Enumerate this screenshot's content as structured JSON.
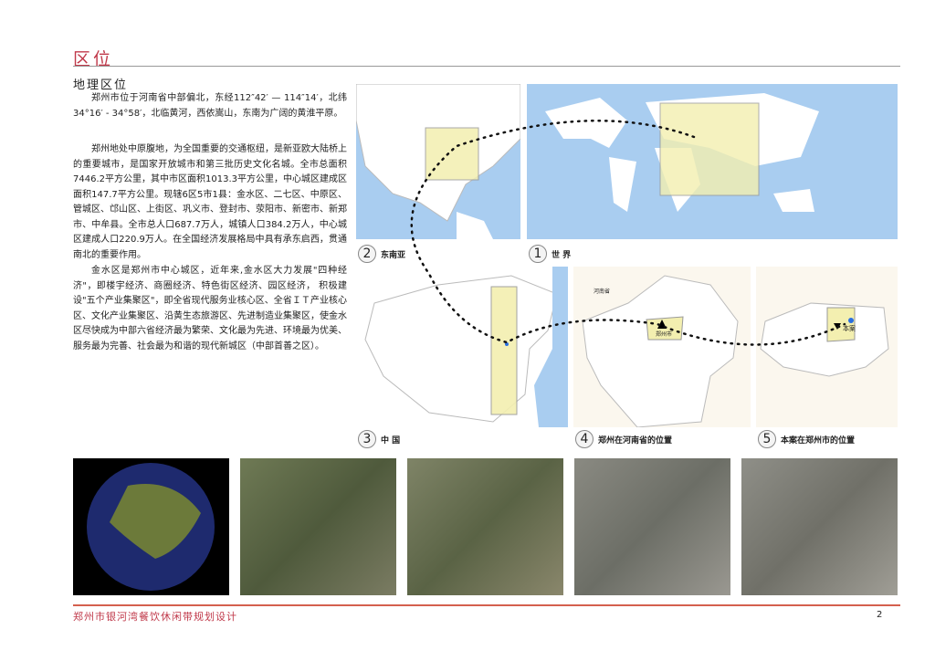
{
  "header": {
    "title": "区位"
  },
  "section": {
    "title": "地理区位",
    "paragraphs": [
      "郑州市位于河南省中部偏北，东经112″42′ — 114″14′，北纬34°16′ - 34°58′，北临黄河，西依嵩山，东南为广阔的黄淮平原。",
      "郑州地处中原腹地，为全国重要的交通枢纽，是新亚欧大陆桥上的重要城市，是国家开放城市和第三批历史文化名城。全市总面积7446.2平方公里，其中市区面积1013.3平方公里，中心城区建成区面积147.7平方公里。现辖6区5市1县：金水区、二七区、中原区、管城区、邙山区、上街区、巩义市、登封市、荥阳市、新密市、新郑市、中牟县。全市总人口687.7万人，城镇人口384.2万人，中心城区建成人口220.9万人。在全国经济发展格局中具有承东启西，贯通南北的重要作用。",
      "金水区是郑州市中心城区，近年来,金水区大力发展\"四种经济\"，即楼宇经济、商圈经济、特色街区经济、园区经济， 积极建设\"五个产业集聚区\"，即全省现代服务业核心区、全省ＩＴ产业核心区、文化产业集聚区、沿黄生态旅游区、先进制造业集聚区，使金水区尽快成为中部六省经济最为繁荣、文化最为先进、环境最为优美、服务最为完善、社会最为和谐的现代新城区（中部首善之区）。"
    ]
  },
  "maps": [
    {
      "num": "1",
      "label": "世 界"
    },
    {
      "num": "2",
      "label": "东南亚"
    },
    {
      "num": "3",
      "label": "中 国"
    },
    {
      "num": "4",
      "label": "郑州在河南省的位置",
      "province": "河南省",
      "city": "郑州市"
    },
    {
      "num": "5",
      "label": "本案在郑州市的位置",
      "site": "本案"
    }
  ],
  "colors": {
    "accent": "#c0394a",
    "ocean": "#a9cdf0",
    "highlight": "#f3efb0"
  },
  "footer": {
    "title": "郑州市银河湾餐饮休闲带规划设计",
    "page": "2"
  }
}
